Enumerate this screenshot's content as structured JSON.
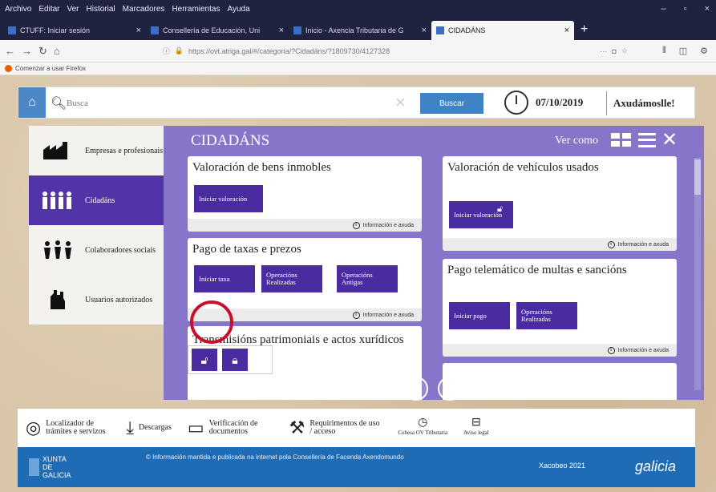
{
  "browser": {
    "menu": [
      "Archivo",
      "Editar",
      "Ver",
      "Historial",
      "Marcadores",
      "Herramientas",
      "Ayuda"
    ],
    "tabs": [
      {
        "label": "CTUFF: Iniciar sesión",
        "active": false
      },
      {
        "label": "Consellería de Educación, Uni",
        "active": false
      },
      {
        "label": "Inicio - Axencia Tributaria de G",
        "active": false
      },
      {
        "label": "CIDADÁNS",
        "active": true
      }
    ],
    "url": "https://ovt.atriga.gal/#/categoria/?Cidadáns/?1809730/4127328",
    "bookmark": "Comenzar a usar Firefox"
  },
  "header": {
    "search_placeholder": "Busca",
    "search_button": "Buscar",
    "date": "07/10/2019",
    "help": "Axudámoslle!"
  },
  "categories": [
    {
      "label": "Empresas e profesionais",
      "active": false,
      "icon": "factory-icon"
    },
    {
      "label": "Cidadáns",
      "active": true,
      "icon": "people-icon"
    },
    {
      "label": "Colaboradores sociais",
      "active": false,
      "icon": "group-icon"
    },
    {
      "label": "Usuarios autorizados",
      "active": false,
      "icon": "hand-icon"
    }
  ],
  "panel": {
    "title": "CIDADÁNS",
    "view_as": "Ver como",
    "info_label": "Información e axuda",
    "cards": [
      {
        "title": "Valoración de bens inmobles",
        "buttons": [
          "Iniciar valoración"
        ]
      },
      {
        "title": "Valoración de vehículos usados",
        "buttons": [
          "Iniciar valoración"
        ]
      },
      {
        "title": "Pago de taxas e prezos",
        "buttons": [
          "Iniciar taxa",
          "Operacións Realizadas",
          "Operacións Antigas"
        ]
      },
      {
        "title": "Pago telemático de multas e sancións",
        "buttons": [
          "Iniciar pago",
          "Operacións Realizadas"
        ]
      },
      {
        "title": "Transmisións patrimoniais e actos xurídicos documentados",
        "buttons": []
      }
    ]
  },
  "footer": {
    "items": [
      "Localizador de trámites e servizos",
      "Descargas",
      "Verificación de documentos",
      "Requirimentos de uso / acceso",
      "Cohesa OV Tributaria",
      "Aviso legal"
    ],
    "org": "XUNTA DE GALICIA",
    "notice": "© Información mantida e publicada na internet pola Consellería de Facenda Axendomundo",
    "xacobeo": "Xacobeo 2021",
    "galicia": "galicia"
  },
  "colors": {
    "purple_panel": "#8675c8",
    "button": "#4b2ca0",
    "active_category": "#5334a8",
    "blue": "#1f6cb5",
    "highlight": "#c8102e"
  }
}
